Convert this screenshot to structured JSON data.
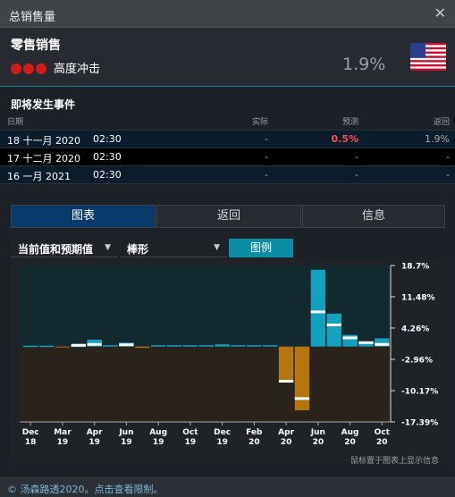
{
  "window": {
    "title": "总销售量"
  },
  "header": {
    "indicator": "零售销售",
    "impact": "高度冲击",
    "value": "1.9%"
  },
  "events": {
    "title": "即将发生事件",
    "columns": {
      "date": "日期",
      "actual": "实际",
      "forecast": "预测",
      "return": "返回"
    },
    "rows": [
      {
        "date": "18 十一月 2020",
        "time": "02:30",
        "actual": "-",
        "forecast": "0.5%",
        "return": "1.9%"
      },
      {
        "date": "17 十二月 2020",
        "time": "02:30",
        "actual": "-",
        "forecast": "-",
        "return": "-"
      },
      {
        "date": "16 一月 2021",
        "time": "02:30",
        "actual": "-",
        "forecast": "-",
        "return": "-"
      }
    ]
  },
  "tabs": {
    "chart": "图表",
    "return": "返回",
    "info": "信息"
  },
  "controls": {
    "series_select": "当前值和预期值",
    "chart_type": "棒形",
    "legend": "图例"
  },
  "chart_data": {
    "type": "bar",
    "y_ticks": [
      "18.7%",
      "11.48%",
      "4.26%",
      "-2.96%",
      "-10.17%",
      "-17.39%"
    ],
    "ylim": [
      -17.39,
      18.7
    ],
    "x_ticks": [
      [
        "Dec",
        "18"
      ],
      [
        "Mar",
        "19"
      ],
      [
        "Apr",
        "19"
      ],
      [
        "Jun",
        "19"
      ],
      [
        "Aug",
        "19"
      ],
      [
        "Oct",
        "19"
      ],
      [
        "Dec",
        "19"
      ],
      [
        "Feb",
        "20"
      ],
      [
        "Apr",
        "20"
      ],
      [
        "Jun",
        "20"
      ],
      [
        "Aug",
        "20"
      ],
      [
        "Oct",
        "20"
      ]
    ],
    "x_tick_index": [
      0,
      2,
      4,
      6,
      8,
      10,
      12,
      14,
      16,
      18,
      20,
      22
    ],
    "values": [
      0.2,
      0.2,
      -0.2,
      0.2,
      1.6,
      0.0,
      0.9,
      -0.3,
      0.0,
      0.0,
      0.0,
      0.0,
      0.5,
      0.0,
      0.0,
      0.0,
      -8.2,
      -14.7,
      17.7,
      7.6,
      2.7,
      1.0,
      1.9
    ],
    "forecasts": [
      null,
      null,
      null,
      0.3,
      0.5,
      null,
      0.4,
      null,
      null,
      null,
      null,
      null,
      null,
      null,
      null,
      null,
      -8.0,
      -12.0,
      8.0,
      5.0,
      2.0,
      0.9,
      0.5
    ],
    "colors": {
      "positive": "#14a1bd",
      "negative": "#b5770d",
      "bg_pos": "#12292f",
      "bg_neg": "#2a231c",
      "forecast": "#ffffff"
    },
    "hint": "鼠标置于图表上显示信息"
  },
  "footer": {
    "text": "© 汤森路透2020。点击查看限制。"
  }
}
